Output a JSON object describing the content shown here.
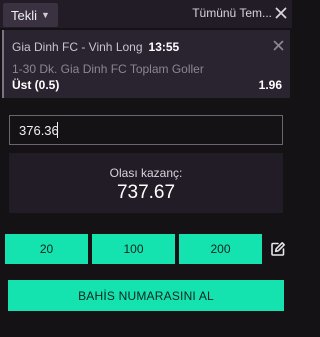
{
  "header": {
    "bet_type": "Tekli",
    "bet_type_caret": "▼",
    "clear_all": "Tümünü Tem..."
  },
  "selection": {
    "match": "Gia Dinh FC - Vinh Long",
    "time": "13:55",
    "market": "1-30 Dk. Gia Dinh FC Toplam Goller",
    "outcome": "Üst (0.5)",
    "odds": "1.96"
  },
  "stake": {
    "value": "376.36"
  },
  "winnings": {
    "label": "Olası kazanç:",
    "value": "737.67"
  },
  "quick_stakes": [
    "20",
    "100",
    "200"
  ],
  "submit_label": "BAHİS NUMARASINI AL",
  "colors": {
    "accent": "#14e3b0",
    "background": "#151216",
    "panel": "#221c26",
    "card": "#2a2330"
  },
  "icons": {
    "header_close": "close-icon",
    "selection_close": "close-icon",
    "edit": "edit-icon"
  }
}
